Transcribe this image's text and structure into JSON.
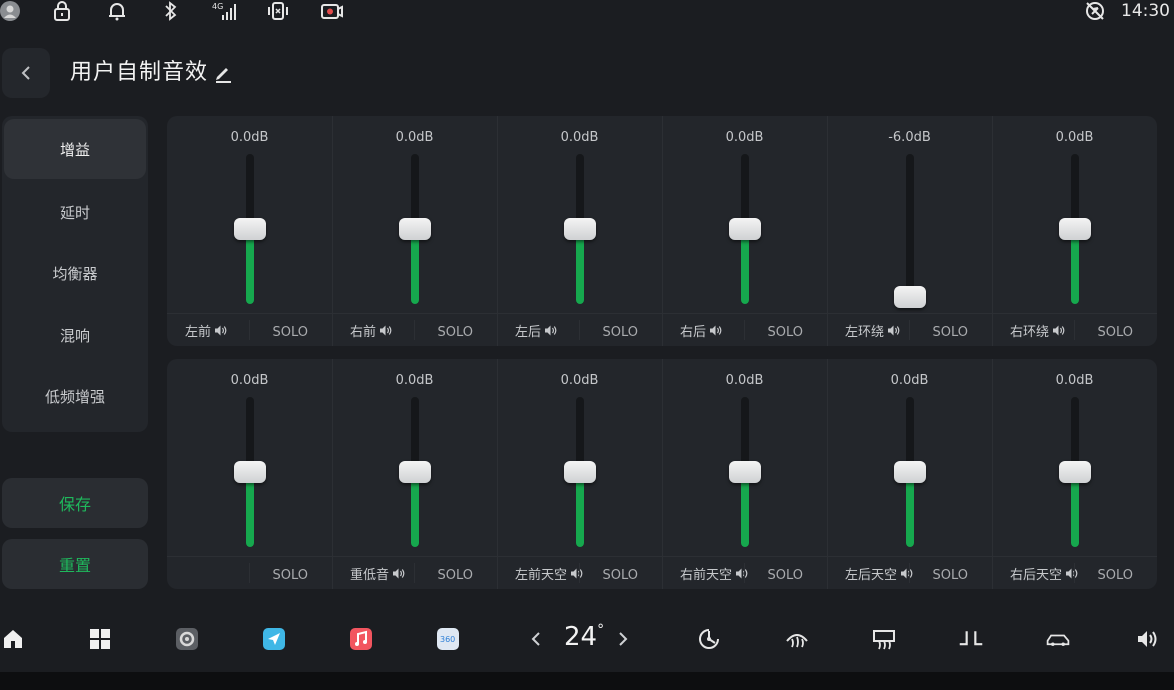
{
  "status_bar": {
    "time": "14:30",
    "icons": [
      "avatar-icon",
      "lock-icon",
      "bell-icon",
      "bluetooth-icon",
      "signal-4g-icon",
      "vibrate-icon",
      "screen-record-icon",
      "no-location-icon"
    ]
  },
  "header": {
    "title": "用户自制音效"
  },
  "sidebar": {
    "items": [
      {
        "label": "增益",
        "active": true
      },
      {
        "label": "延时",
        "active": false
      },
      {
        "label": "均衡器",
        "active": false
      },
      {
        "label": "混响",
        "active": false
      },
      {
        "label": "低频增强",
        "active": false
      }
    ],
    "save_label": "保存",
    "reset_label": "重置"
  },
  "solo_label": "SOLO",
  "channels_row1": [
    {
      "db": "0.0dB",
      "label": "左前",
      "level": 0.5
    },
    {
      "db": "0.0dB",
      "label": "右前",
      "level": 0.5
    },
    {
      "db": "0.0dB",
      "label": "左后",
      "level": 0.5
    },
    {
      "db": "0.0dB",
      "label": "右后",
      "level": 0.5
    },
    {
      "db": "-6.0dB",
      "label": "左环绕",
      "level": 0.05
    },
    {
      "db": "0.0dB",
      "label": "右环绕",
      "level": 0.5
    }
  ],
  "channels_row2": [
    {
      "db": "0.0dB",
      "label": "",
      "level": 0.5
    },
    {
      "db": "0.0dB",
      "label": "重低音",
      "level": 0.5
    },
    {
      "db": "0.0dB",
      "label": "左前天空",
      "level": 0.5
    },
    {
      "db": "0.0dB",
      "label": "右前天空",
      "level": 0.5
    },
    {
      "db": "0.0dB",
      "label": "左后天空",
      "level": 0.5
    },
    {
      "db": "0.0dB",
      "label": "右后天空",
      "level": 0.5
    }
  ],
  "dock": {
    "temperature": "24",
    "degree": "°",
    "icons": [
      "home-icon",
      "apps-grid-icon",
      "settings-app-icon",
      "navigation-app-icon",
      "music-app-icon",
      "camera-360-icon",
      "fan-icon",
      "rear-defrost-icon",
      "front-defrost-icon",
      "seat-icon",
      "car-icon",
      "volume-icon"
    ]
  },
  "colors": {
    "accent": "#16a84e",
    "accent_text": "#1fb85c",
    "background": "#1b1d21",
    "panel": "#23262b"
  }
}
